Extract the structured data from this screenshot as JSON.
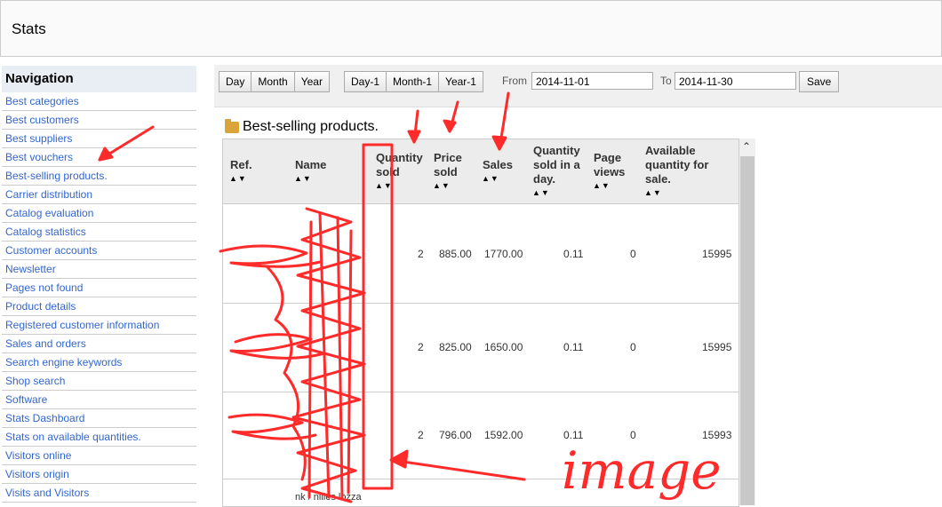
{
  "page": {
    "title": "Stats"
  },
  "nav": {
    "heading": "Navigation",
    "items": [
      "Best categories",
      "Best customers",
      "Best suppliers",
      "Best vouchers",
      "Best-selling products.",
      "Carrier distribution",
      "Catalog evaluation",
      "Catalog statistics",
      "Customer accounts",
      "Newsletter",
      "Pages not found",
      "Product details",
      "Registered customer information",
      "Sales and orders",
      "Search engine keywords",
      "Shop search",
      "Software",
      "Stats Dashboard",
      "Stats on available quantities.",
      "Visitors online",
      "Visitors origin",
      "Visits and Visitors"
    ]
  },
  "toolbar": {
    "day": "Day",
    "month": "Month",
    "year": "Year",
    "day_prev": "Day-1",
    "month_prev": "Month-1",
    "year_prev": "Year-1",
    "from_label": "From",
    "from_value": "2014-11-01",
    "to_label": "To",
    "to_value": "2014-11-30",
    "save": "Save"
  },
  "panel": {
    "title": "Best-selling products.",
    "columns": {
      "ref": "Ref.",
      "name": "Name",
      "qty_sold_1": "Quantity",
      "qty_sold_2": "sold",
      "price_sold_1": "Price",
      "price_sold_2": "sold",
      "sales": "Sales",
      "qty_day_1": "Quantity",
      "qty_day_2": "sold in a",
      "qty_day_3": "day.",
      "page_views_1": "Page",
      "page_views_2": "views",
      "avail_1": "Available",
      "avail_2": "quantity for",
      "avail_3": "sale."
    },
    "sort_arrows": "▲▼",
    "rows": [
      {
        "qty": "2",
        "price": "885.00",
        "sales": "1770.00",
        "per_day": "0.11",
        "views": "0",
        "available": "15995"
      },
      {
        "qty": "2",
        "price": "825.00",
        "sales": "1650.00",
        "per_day": "0.11",
        "views": "0",
        "available": "15995"
      },
      {
        "qty": "2",
        "price": "796.00",
        "sales": "1592.00",
        "per_day": "0.11",
        "views": "0",
        "available": "15993"
      },
      {
        "name_fragment": "nk / nilles lozza"
      }
    ]
  },
  "annotation": {
    "text": "image",
    "color": "#ff2a2a"
  }
}
